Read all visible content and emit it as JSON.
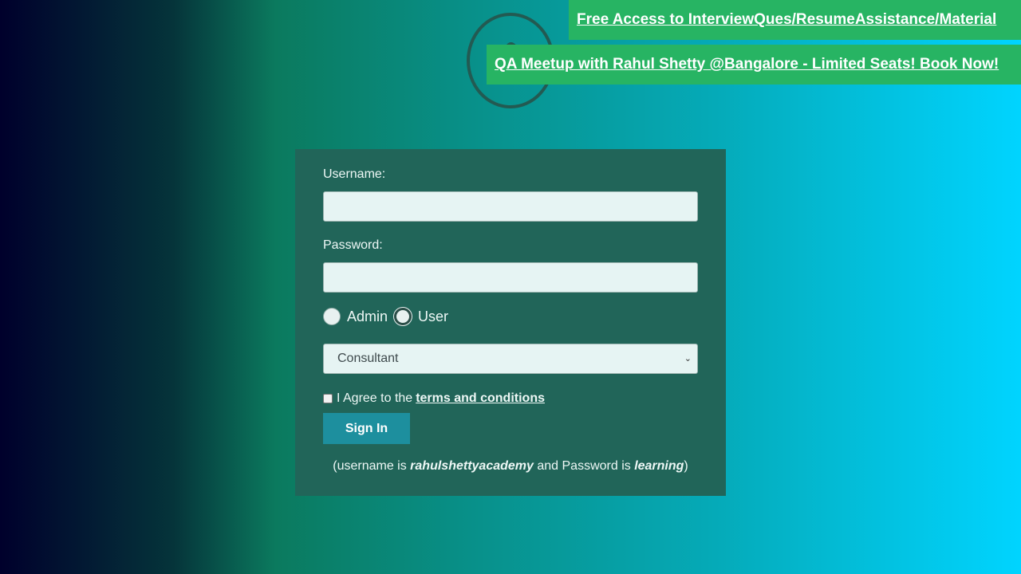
{
  "banners": {
    "interview_material": "Free Access to InterviewQues/ResumeAssistance/Material",
    "qa_meetup": "QA Meetup with Rahul Shetty @Bangalore - Limited Seats! Book Now!"
  },
  "login": {
    "username_label": "Username:",
    "username_value": "",
    "password_label": "Password:",
    "password_value": "",
    "role_options": [
      "Admin",
      "User"
    ],
    "role_selected": "User",
    "dropdown_selected": "Consultant",
    "agree_prefix": "I Agree to the",
    "terms_link": "terms and conditions",
    "agree_checked": false,
    "signin_label": "Sign In",
    "hint": {
      "prefix": "(username is ",
      "username": "rahulshettyacademy",
      "middle": " and Password is ",
      "password": "learning",
      "suffix": ")"
    }
  },
  "colors": {
    "banner_bg": "#27b463",
    "card_bg": "#216559",
    "button_bg": "#1d8f9e",
    "gradient_start": "#00002c",
    "gradient_end": "#00d4ff"
  },
  "icons": {
    "logo": "circular-logo-icon",
    "dropdown": "chevron-down-icon"
  }
}
